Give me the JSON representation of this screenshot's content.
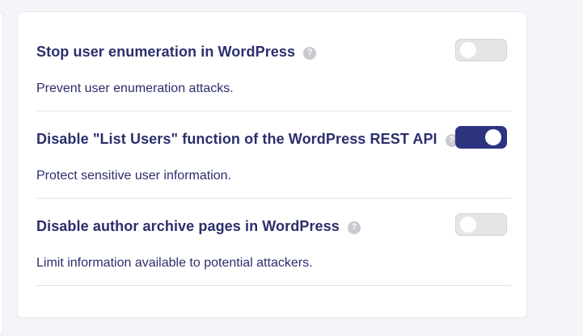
{
  "settings": [
    {
      "title": "Stop user enumeration in WordPress",
      "description": "Prevent user enumeration attacks.",
      "enabled": false
    },
    {
      "title": "Disable \"List Users\" function of the WordPress REST API",
      "description": "Protect sensitive user information.",
      "enabled": true
    },
    {
      "title": "Disable author archive pages in WordPress",
      "description": "Limit information available to potential attackers.",
      "enabled": false
    }
  ],
  "help_glyph": "?",
  "colors": {
    "accent": "#2c3480",
    "text": "#2b2f6c",
    "toggle_off": "#e5e5e7"
  }
}
